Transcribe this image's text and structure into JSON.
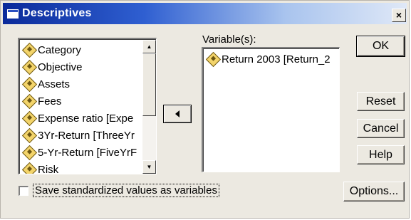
{
  "window": {
    "title": "Descriptives",
    "close_label": "×"
  },
  "source_list": {
    "items": [
      {
        "label": "Category",
        "icon": "ruler-icon"
      },
      {
        "label": "Objective",
        "icon": "ruler-icon"
      },
      {
        "label": "Assets",
        "icon": "ruler-icon"
      },
      {
        "label": "Fees",
        "icon": "ruler-icon"
      },
      {
        "label": "Expense ratio [Expe",
        "icon": "ruler-icon"
      },
      {
        "label": "3Yr-Return [ThreeYr",
        "icon": "ruler-icon"
      },
      {
        "label": "5-Yr-Return [FiveYrF",
        "icon": "ruler-icon"
      },
      {
        "label": "Risk",
        "icon": "ruler-icon"
      }
    ],
    "scroll_up_label": "▲",
    "scroll_down_label": "▼"
  },
  "move_button": {
    "icon": "arrow-left-icon"
  },
  "target_list": {
    "label": "Variable(s):",
    "items": [
      {
        "label": "Return 2003 [Return_2",
        "icon": "ruler-icon"
      }
    ]
  },
  "buttons": {
    "ok": "OK",
    "reset": "Reset",
    "cancel": "Cancel",
    "help": "Help",
    "options": "Options..."
  },
  "save_standardized": {
    "label": "Save standardized values as variables",
    "checked": false
  },
  "colors": {
    "titlebar_start": "#0a2a9a",
    "dialog_face": "#ece9e1",
    "icon_fill": "#f3d46a"
  }
}
